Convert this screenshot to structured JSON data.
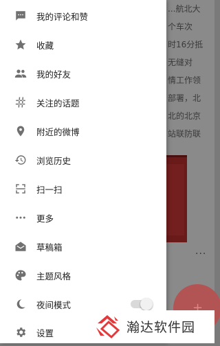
{
  "background_feed": {
    "text_lines": [
      "...航北大",
      "个车次",
      "时16分抵",
      "无缝对",
      "情工作领",
      "部署，北",
      "北的北京",
      "站联防联"
    ],
    "more_dots": "···",
    "fab_symbol": "+"
  },
  "drawer": {
    "items": [
      {
        "label": "我的评论和赞",
        "icon": "comment-icon"
      },
      {
        "label": "收藏",
        "icon": "star-icon"
      },
      {
        "label": "我的好友",
        "icon": "people-icon"
      },
      {
        "label": "关注的话题",
        "icon": "hashtag-icon"
      },
      {
        "label": "附近的微博",
        "icon": "location-pin-icon"
      },
      {
        "label": "浏览历史",
        "icon": "history-icon"
      },
      {
        "label": "扫一扫",
        "icon": "scan-icon"
      },
      {
        "label": "更多",
        "icon": "more-dots-icon"
      },
      {
        "label": "草稿箱",
        "icon": "draft-box-icon"
      },
      {
        "label": "主题风格",
        "icon": "palette-icon"
      },
      {
        "label": "夜间模式",
        "icon": "night-mode-icon",
        "toggle": false
      },
      {
        "label": "设置",
        "icon": "gear-icon"
      }
    ]
  },
  "watermark": {
    "text": "瀚达软件园",
    "logo": "watermark-logo-icon",
    "logo_color": "#e23a3a"
  },
  "colors": {
    "drawer_bg": "#ffffff",
    "icon": "#707070",
    "label": "#222222",
    "overlay": "#8a8a8a"
  }
}
